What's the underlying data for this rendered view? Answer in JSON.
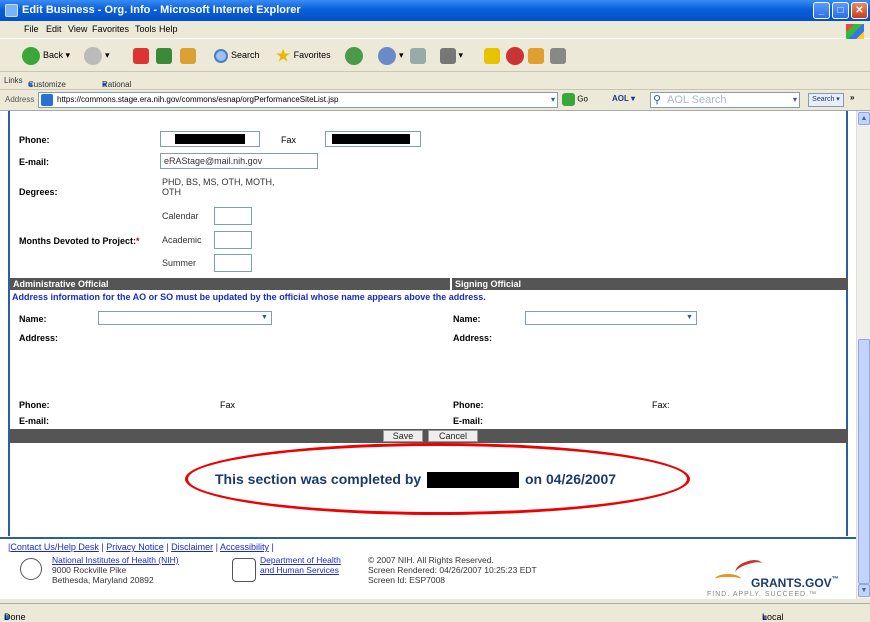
{
  "window": {
    "title": "Edit Business - Org. Info - Microsoft Internet Explorer",
    "controls": [
      "_",
      "□",
      "✕"
    ]
  },
  "menu": [
    "File",
    "Edit",
    "View",
    "Favorites",
    "Tools",
    "Help"
  ],
  "toolbar": {
    "back": "Back",
    "search": "Search",
    "favorites": "Favorites"
  },
  "links": {
    "label": "Links",
    "items": [
      "Customize Links",
      "Rational"
    ]
  },
  "address": {
    "label": "Address",
    "url": "https://commons.stage.era.nih.gov/commons/esnap/orgPerformanceSiteList.jsp",
    "go": "Go",
    "aol": "AOL",
    "aol_search": "AOL Search",
    "search_btn": "Search",
    "more": "»"
  },
  "form": {
    "phone_label": "Phone:",
    "fax_label": "Fax",
    "email_label": "E-mail:",
    "email_value": "eRAStage@mail.nih.gov",
    "degrees_label": "Degrees:",
    "degrees_line1": "PHD, BS, MS, OTH, MOTH,",
    "degrees_line2": "OTH",
    "months_label": "Months Devoted to Project:",
    "required_mark": "*",
    "calendar": "Calendar",
    "academic": "Academic",
    "summer": "Summer"
  },
  "officials": {
    "admin_header": "Administrative Official",
    "signing_header": "Signing Official",
    "note": "Address information for the AO or SO must be updated by the official whose name appears above the address.",
    "name_label": "Name:",
    "address_label": "Address:",
    "phone_label": "Phone:",
    "fax_label": "Fax",
    "fax_label_right": "Fax:",
    "email_label": "E-mail:",
    "email_label_right": "E-mail:"
  },
  "buttons": {
    "save": "Save",
    "cancel": "Cancel"
  },
  "completion": {
    "prefix": "This section was completed by",
    "suffix": "on 04/26/2007"
  },
  "footer": {
    "links": [
      "Contact Us/Help Desk",
      "Privacy Notice",
      "Disclaimer",
      "Accessibility"
    ],
    "nih_name": "National Institutes of Health (NIH)",
    "nih_addr1": "9000 Rockville Pike",
    "nih_addr2": "Bethesda, Maryland 20892",
    "hhs_line1": "Department of Health",
    "hhs_line2": "and Human Services",
    "copyright": "© 2007 NIH. All Rights Reserved.",
    "rendered": "Screen Rendered: 04/26/2007 10:25:23 EDT",
    "screen_id": "Screen Id: ESP7008",
    "grants_name": "GRANTS.GOV",
    "grants_tm": "™",
    "grants_tagline": "FIND. APPLY. SUCCEED.™"
  },
  "status": {
    "left": "Done",
    "zone": "Local intranet"
  },
  "colors": {
    "title_bar": "#0a5fd8",
    "section_header": "#555555",
    "link_blue": "#1a2bc8",
    "annotation_red": "#e00000"
  }
}
